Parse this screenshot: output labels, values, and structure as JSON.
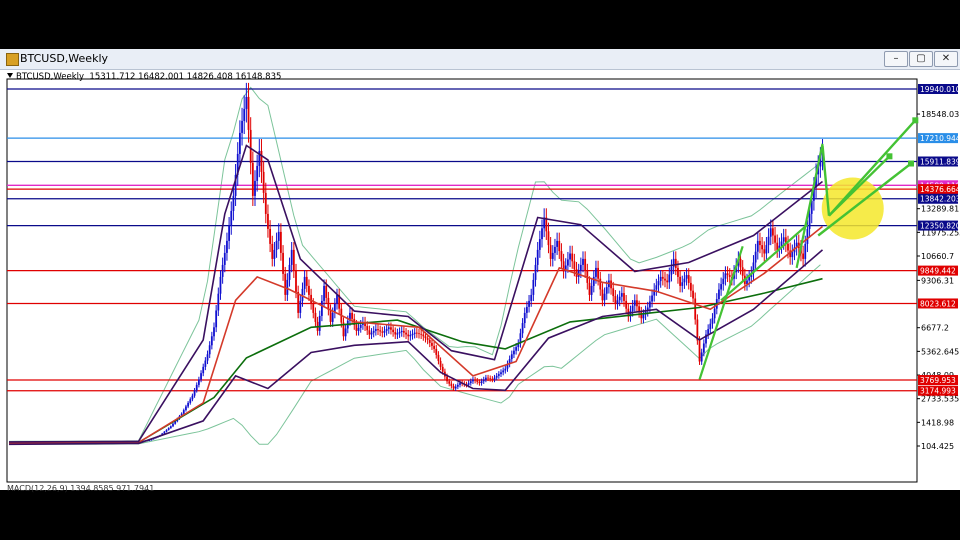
{
  "window": {
    "title": "BTCUSD,Weekly",
    "minimize_glyph": "–",
    "maximize_glyph": "▢",
    "close_glyph": "✕"
  },
  "chart_header": {
    "symbol": "BTCUSD,Weekly",
    "ohlc": "15311.712 16482.001 14826.408 16148.835"
  },
  "bottom_indicator": "MACD(12,26,9) 1394.8585 971.7941",
  "colors": {
    "bull_candle": "#1010d0",
    "bear_candle": "#e00000",
    "hline_navy": "#0a0a8a",
    "hline_light": "#2a8ee8",
    "hline_magenta": "#e02ac8",
    "hline_red": "#e00000",
    "ma_green": "#0c6e0c",
    "ma_red": "#d43a2a",
    "band_purple": "#3a1060",
    "band_thin": "#7cc49a",
    "arrow_green": "#44c234",
    "highlight_yellow": "#f4e82a"
  },
  "chart_data": {
    "type": "candlestick",
    "symbol": "BTCUSD",
    "timeframe": "Weekly",
    "ylim": [
      104.425,
      20000
    ],
    "price_ticks": [
      18548.03,
      13289.81,
      11975.255,
      10660.7,
      9306.31,
      6677.2,
      5362.645,
      4048.09,
      2733.535,
      1418.98,
      104.425
    ],
    "price_levels": [
      {
        "value": 19940.01,
        "label": "19940.010",
        "color": "navy"
      },
      {
        "value": 17210.944,
        "label": "17210.944",
        "color": "light-blue"
      },
      {
        "value": 15911.839,
        "label": "15911.839",
        "color": "navy"
      },
      {
        "value": 14589.118,
        "label": "14589.118",
        "color": "magenta"
      },
      {
        "value": 14376.664,
        "label": "14376.664",
        "color": "red"
      },
      {
        "value": 13842.203,
        "label": "13842.203",
        "color": "navy"
      },
      {
        "value": 12350.82,
        "label": "12350.820",
        "color": "navy"
      },
      {
        "value": 9849.442,
        "label": "9849.442",
        "color": "red"
      },
      {
        "value": 8023.612,
        "label": "8023.612",
        "color": "red"
      },
      {
        "value": 3769.953,
        "label": "3769.953",
        "color": "red"
      },
      {
        "value": 3174.993,
        "label": "3174.993",
        "color": "red"
      }
    ],
    "price_path": [
      [
        0,
        300
      ],
      [
        20,
        320
      ],
      [
        40,
        330
      ],
      [
        55,
        360
      ],
      [
        65,
        420
      ],
      [
        70,
        700
      ],
      [
        75,
        1200
      ],
      [
        80,
        1900
      ],
      [
        85,
        2900
      ],
      [
        88,
        3800
      ],
      [
        92,
        5200
      ],
      [
        95,
        6700
      ],
      [
        98,
        9500
      ],
      [
        101,
        11500
      ],
      [
        104,
        14000
      ],
      [
        107,
        17500
      ],
      [
        110,
        19500
      ],
      [
        113,
        14000
      ],
      [
        116,
        16500
      ],
      [
        119,
        13000
      ],
      [
        122,
        10500
      ],
      [
        125,
        12000
      ],
      [
        128,
        8500
      ],
      [
        131,
        11000
      ],
      [
        134,
        7500
      ],
      [
        137,
        9500
      ],
      [
        140,
        8000
      ],
      [
        143,
        6500
      ],
      [
        146,
        9000
      ],
      [
        149,
        7000
      ],
      [
        152,
        8500
      ],
      [
        155,
        6200
      ],
      [
        158,
        7500
      ],
      [
        161,
        6500
      ],
      [
        164,
        7000
      ],
      [
        167,
        6300
      ],
      [
        170,
        6600
      ],
      [
        173,
        6400
      ],
      [
        176,
        6700
      ],
      [
        179,
        6300
      ],
      [
        182,
        6500
      ],
      [
        185,
        6200
      ],
      [
        188,
        6400
      ],
      [
        191,
        6300
      ],
      [
        194,
        6000
      ],
      [
        197,
        5500
      ],
      [
        200,
        4500
      ],
      [
        203,
        3700
      ],
      [
        206,
        3300
      ],
      [
        209,
        3600
      ],
      [
        212,
        3500
      ],
      [
        215,
        3800
      ],
      [
        218,
        3600
      ],
      [
        221,
        3900
      ],
      [
        224,
        3800
      ],
      [
        227,
        4100
      ],
      [
        230,
        4400
      ],
      [
        233,
        5200
      ],
      [
        236,
        5800
      ],
      [
        239,
        7500
      ],
      [
        242,
        8500
      ],
      [
        245,
        11000
      ],
      [
        248,
        12800
      ],
      [
        251,
        10500
      ],
      [
        254,
        11500
      ],
      [
        257,
        9800
      ],
      [
        260,
        10800
      ],
      [
        263,
        9500
      ],
      [
        266,
        10500
      ],
      [
        269,
        8500
      ],
      [
        272,
        10000
      ],
      [
        275,
        8200
      ],
      [
        278,
        9300
      ],
      [
        281,
        8000
      ],
      [
        284,
        8600
      ],
      [
        287,
        7300
      ],
      [
        290,
        8200
      ],
      [
        293,
        7200
      ],
      [
        296,
        7800
      ],
      [
        299,
        8800
      ],
      [
        302,
        9500
      ],
      [
        305,
        9200
      ],
      [
        308,
        10500
      ],
      [
        311,
        9000
      ],
      [
        314,
        9600
      ],
      [
        317,
        8300
      ],
      [
        320,
        4800
      ],
      [
        323,
        6300
      ],
      [
        326,
        7200
      ],
      [
        329,
        8800
      ],
      [
        332,
        9700
      ],
      [
        335,
        9400
      ],
      [
        338,
        10500
      ],
      [
        341,
        9100
      ],
      [
        344,
        9700
      ],
      [
        347,
        11500
      ],
      [
        350,
        10800
      ],
      [
        353,
        12200
      ],
      [
        356,
        11000
      ],
      [
        359,
        11700
      ],
      [
        362,
        10600
      ],
      [
        365,
        11400
      ],
      [
        368,
        10500
      ],
      [
        371,
        13000
      ],
      [
        374,
        15200
      ],
      [
        377,
        16500
      ]
    ],
    "moving_averages": [
      {
        "name": "",
        "color": "green",
        "points": [
          [
            0,
            250
          ],
          [
            60,
            300
          ],
          [
            95,
            2800
          ],
          [
            110,
            5000
          ],
          [
            140,
            6700
          ],
          [
            180,
            7100
          ],
          [
            210,
            5900
          ],
          [
            230,
            5500
          ],
          [
            260,
            7000
          ],
          [
            290,
            7400
          ],
          [
            320,
            7800
          ],
          [
            350,
            8600
          ],
          [
            377,
            9400
          ]
        ]
      },
      {
        "name": "",
        "color": "red",
        "points": [
          [
            0,
            260
          ],
          [
            60,
            300
          ],
          [
            90,
            2500
          ],
          [
            105,
            8200
          ],
          [
            115,
            9500
          ],
          [
            130,
            8800
          ],
          [
            160,
            7000
          ],
          [
            190,
            6700
          ],
          [
            215,
            4000
          ],
          [
            235,
            4800
          ],
          [
            255,
            10000
          ],
          [
            275,
            9200
          ],
          [
            300,
            8700
          ],
          [
            325,
            7700
          ],
          [
            350,
            9700
          ],
          [
            377,
            12300
          ]
        ]
      },
      {
        "name": "",
        "color": "purple-upper",
        "points": [
          [
            0,
            330
          ],
          [
            60,
            360
          ],
          [
            90,
            6000
          ],
          [
            100,
            13000
          ],
          [
            110,
            16800
          ],
          [
            120,
            16000
          ],
          [
            135,
            10500
          ],
          [
            160,
            7600
          ],
          [
            185,
            7300
          ],
          [
            205,
            5400
          ],
          [
            225,
            4900
          ],
          [
            245,
            12800
          ],
          [
            265,
            12400
          ],
          [
            290,
            9800
          ],
          [
            315,
            10300
          ],
          [
            345,
            11800
          ],
          [
            377,
            14800
          ]
        ]
      },
      {
        "name": "",
        "color": "purple-lower",
        "points": [
          [
            0,
            200
          ],
          [
            60,
            250
          ],
          [
            90,
            1500
          ],
          [
            105,
            4000
          ],
          [
            120,
            3300
          ],
          [
            140,
            5300
          ],
          [
            160,
            5700
          ],
          [
            185,
            5900
          ],
          [
            200,
            4200
          ],
          [
            215,
            3300
          ],
          [
            230,
            3200
          ],
          [
            250,
            6100
          ],
          [
            275,
            7300
          ],
          [
            300,
            7700
          ],
          [
            320,
            6000
          ],
          [
            345,
            7700
          ],
          [
            377,
            11000
          ]
        ]
      }
    ],
    "annotations": {
      "trend_lines": [
        {
          "from": [
            320,
            3800
          ],
          "to": [
            340,
            11200
          ]
        },
        {
          "from": [
            330,
            8200
          ],
          "to": [
            370,
            12400
          ]
        },
        {
          "from": [
            365,
            10000
          ],
          "to": [
            377,
            16900
          ]
        }
      ],
      "projection_arrows": [
        {
          "from": [
            377,
            16800
          ],
          "to": [
            380,
            12900
          ],
          "next": [
            420,
            18200
          ]
        },
        {
          "from": [
            380,
            12900
          ],
          "to": [
            408,
            16200
          ]
        },
        {
          "from": [
            375,
            11800
          ],
          "to": [
            418,
            15800
          ]
        }
      ],
      "highlight_circle": {
        "center": [
          391,
          13300
        ],
        "radius_units": "price"
      }
    }
  }
}
